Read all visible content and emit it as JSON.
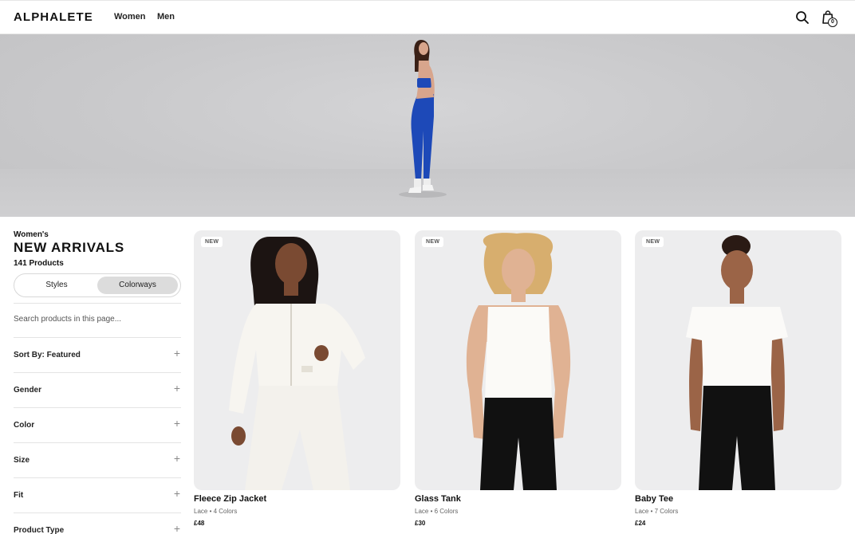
{
  "header": {
    "logo": "ALPHALETE",
    "nav": [
      "Women",
      "Men"
    ],
    "cart_count": "0"
  },
  "hero": {
    "icon": "hero-model-image"
  },
  "sidebar": {
    "eyebrow": "Women's",
    "title": "NEW ARRIVALS",
    "count": "141 Products",
    "toggle": {
      "styles": "Styles",
      "colorways": "Colorways",
      "selected": "Colorways"
    },
    "search_placeholder": "Search products in this page...",
    "filters": [
      "Sort By: Featured",
      "Gender",
      "Color",
      "Size",
      "Fit",
      "Product Type"
    ]
  },
  "products": [
    {
      "badge": "NEW",
      "name": "Fleece Zip Jacket",
      "meta": "Lace • 4 Colors",
      "price": "£48"
    },
    {
      "badge": "NEW",
      "name": "Glass Tank",
      "meta": "Lace • 6 Colors",
      "price": "£30"
    },
    {
      "badge": "NEW",
      "name": "Baby Tee",
      "meta": "Lace • 7 Colors",
      "price": "£24"
    }
  ],
  "colors": {
    "accent_blue": "#1d49b8",
    "text": "#111111",
    "toggle_selected": "#dcdcdc"
  }
}
